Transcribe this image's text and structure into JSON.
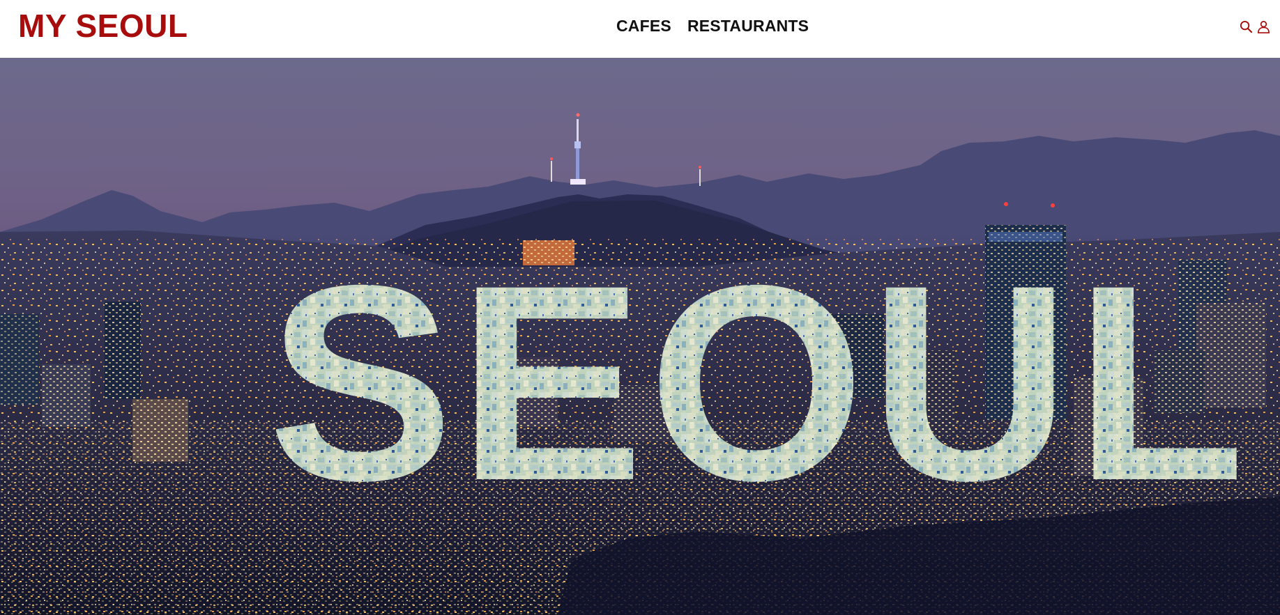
{
  "header": {
    "logo": "MY SEOUL",
    "nav": [
      {
        "label": "CAFES"
      },
      {
        "label": "RESTAURANTS"
      }
    ],
    "icons": [
      "search-icon",
      "user-icon"
    ]
  },
  "hero": {
    "overlay_text": "SEOUL",
    "scene": "night-city-skyline-with-n-seoul-tower"
  },
  "colors": {
    "brand": "#a80d0d",
    "nav_text": "#111111",
    "sky_top": "#6e6a8e",
    "sky_bottom": "#6d5a86"
  }
}
